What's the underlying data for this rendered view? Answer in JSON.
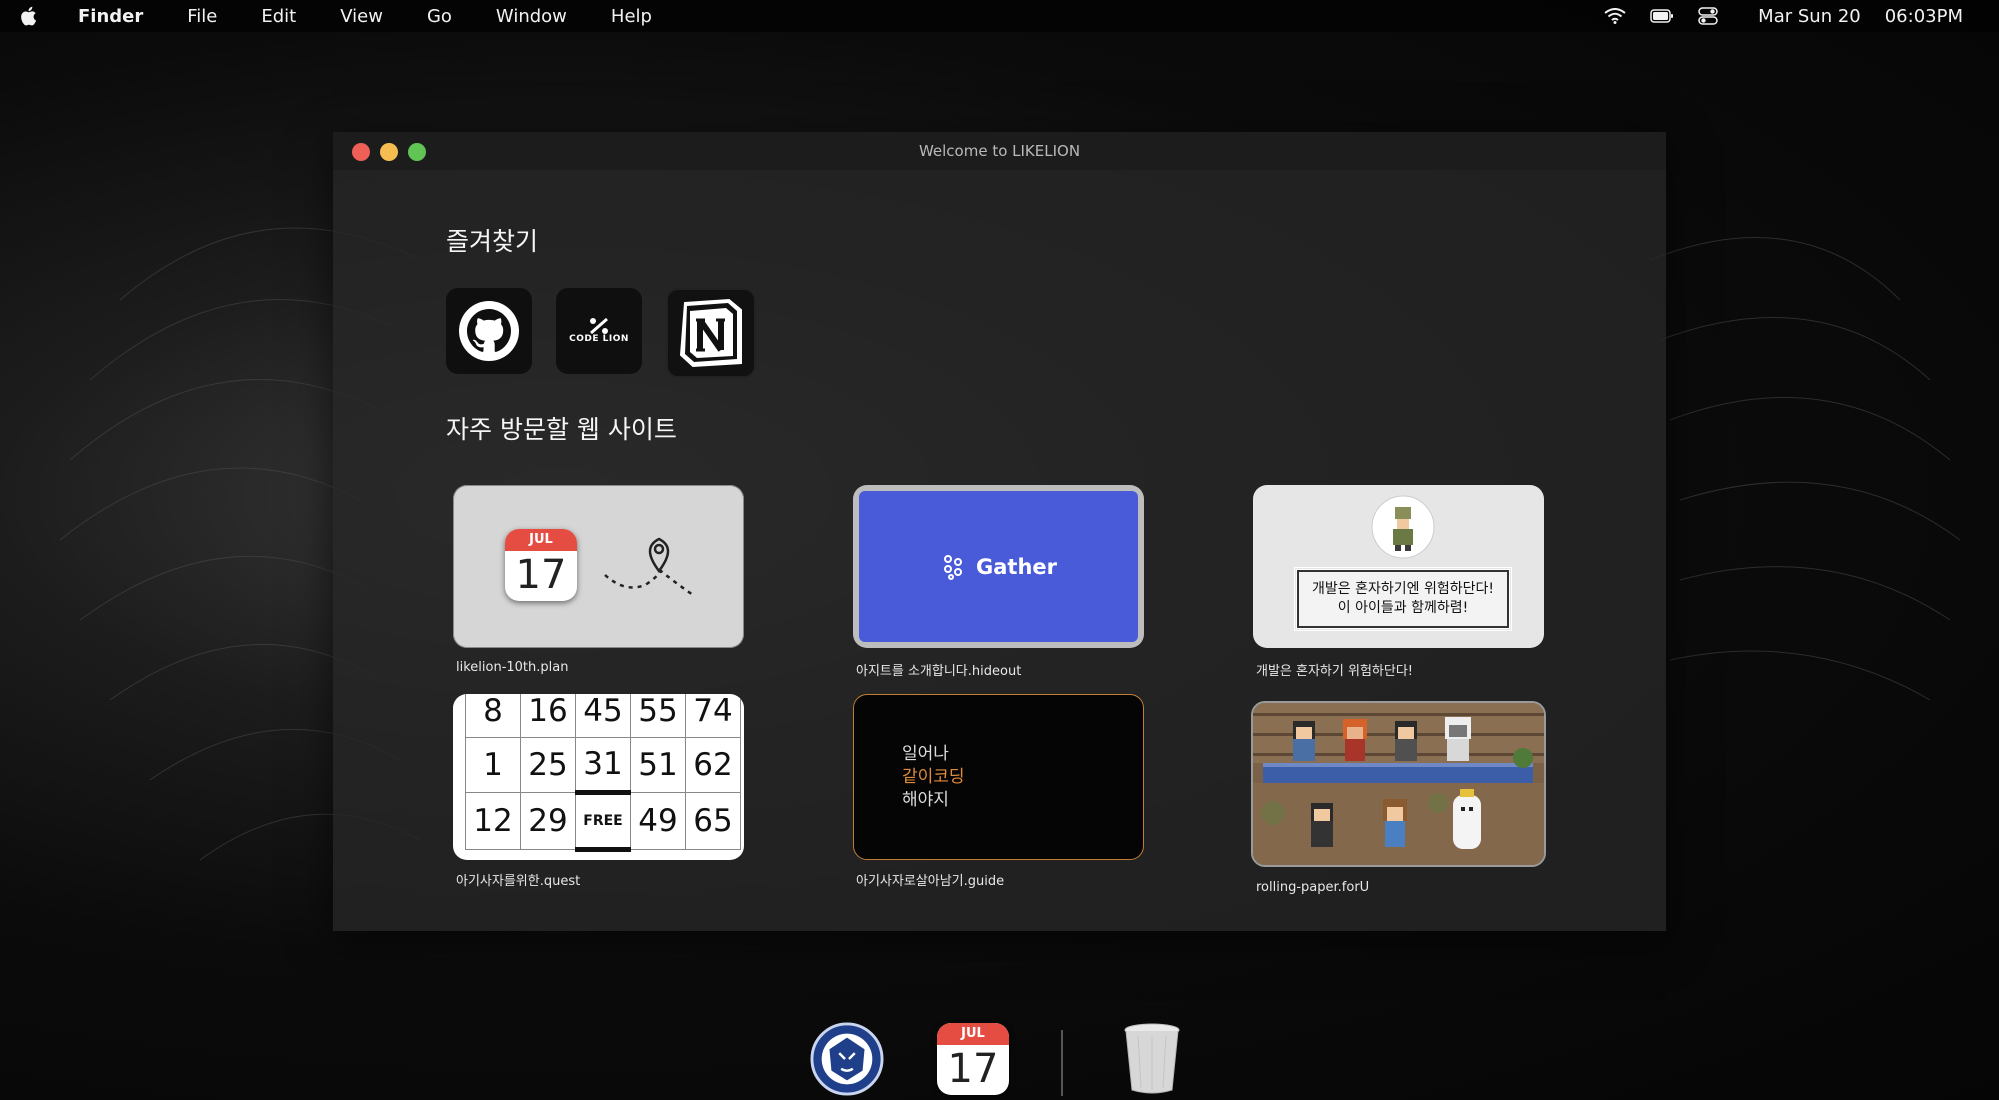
{
  "menubar": {
    "app": "Finder",
    "items": [
      "File",
      "Edit",
      "View",
      "Go",
      "Window",
      "Help"
    ],
    "date": "Mar Sun 20",
    "time": "06:03PM"
  },
  "window": {
    "title": "Welcome to LIKELION"
  },
  "favorites": {
    "title": "즐겨찾기",
    "items": [
      {
        "name": "GitHub",
        "icon": "github-icon"
      },
      {
        "name": "CODE LION",
        "icon": "codelion-icon"
      },
      {
        "name": "Notion",
        "icon": "notion-icon"
      }
    ],
    "codelion_text": "CODE LION"
  },
  "sites": {
    "title": "자주 방문할 웹 사이트",
    "cards": [
      {
        "label": "likelion-10th.plan",
        "cal_month": "JUL",
        "cal_day": "17"
      },
      {
        "label": "아지트를 소개합니다.hideout",
        "brand": "Gather"
      },
      {
        "label": "개발은 혼자하기 위험하단다!",
        "line1": "개발은 혼자하기엔 위험하단다!",
        "line2": "이 아이들과 함께하렴!"
      },
      {
        "label": "아기사자를위한.quest",
        "grid": [
          [
            "8",
            "16",
            "45",
            "55",
            "74"
          ],
          [
            "1",
            "25",
            "31",
            "51",
            "62"
          ],
          [
            "12",
            "29",
            "FREE",
            "49",
            "65"
          ]
        ]
      },
      {
        "label": "아기사자로살아남기.guide",
        "line1": "일어나",
        "line2": "같이코딩",
        "line3": "해야지"
      },
      {
        "label": "rolling-paper.forU"
      }
    ]
  },
  "dock": {
    "cal_month": "JUL",
    "cal_day": "17"
  }
}
